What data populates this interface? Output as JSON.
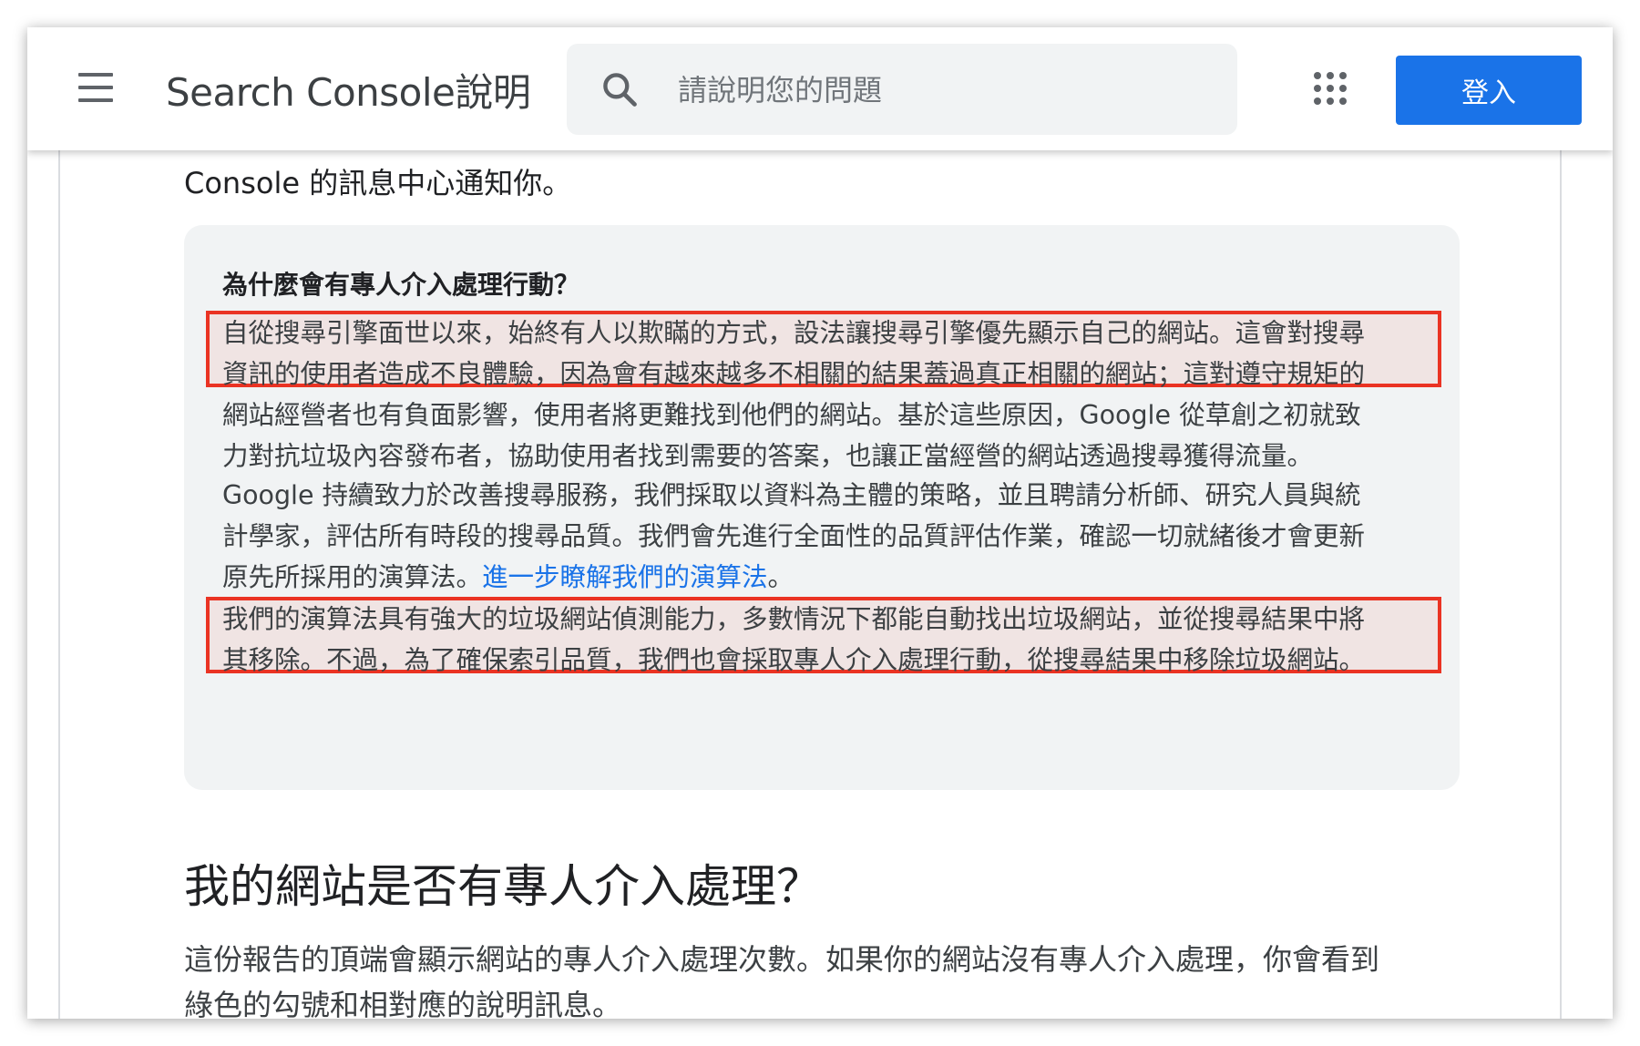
{
  "header": {
    "app_title": "Search Console說明",
    "search": {
      "placeholder": "請說明您的問題"
    },
    "signin_label": "登入"
  },
  "article": {
    "intro_text": "Console 的訊息中心通知你。",
    "callout": {
      "title": "為什麼會有專人介入處理行動？",
      "paragraph_1": {
        "lines": [
          "自從搜尋引擎面世以來，始終有人以欺瞞的方式，設法讓搜尋引擎優先顯示自己的網站。這會對搜尋",
          "資訊的使用者造成不良體驗，因為會有越來越多不相關的結果蓋過真正相關的網站；這對遵守規矩的",
          "網站經營者也有負面影響，使用者將更難找到他們的網站。基於這些原因，Google 從草創之初就致",
          "力對抗垃圾內容發布者，協助使用者找到需要的答案，也讓正當經營的網站透過搜尋獲得流量。"
        ]
      },
      "paragraph_2": {
        "lines": [
          "Google 持續致力於改善搜尋服務，我們採取以資料為主體的策略，並且聘請分析師、研究人員與統",
          "計學家，評估所有時段的搜尋品質。我們會先進行全面性的品質評估作業，確認一切就緒後才會更新"
        ],
        "line_3_prefix": "原先所採用的演算法。",
        "link_text": "進一步瞭解我們的演算法",
        "line_3_suffix": "。"
      },
      "paragraph_3": {
        "lines": [
          "我們的演算法具有強大的垃圾網站偵測能力，多數情況下都能自動找出垃圾網站，並從搜尋結果中將",
          "其移除。不過，為了確保索引品質，我們也會採取專人介入處理行動，從搜尋結果中移除垃圾網站。"
        ]
      }
    },
    "section": {
      "heading": "我的網站是否有專人介入處理？",
      "body_lines": [
        "這份報告的頂端會顯示網站的專人介入處理次數。如果你的網站沒有專人介入處理，你會看到",
        "綠色的勾號和相對應的說明訊息。"
      ]
    }
  },
  "colors": {
    "accent": "#1a73e8",
    "highlight_border": "#ea3323",
    "callout_bg": "#f1f3f4"
  },
  "icons": [
    "menu-icon",
    "search-icon",
    "apps-grid-icon"
  ]
}
